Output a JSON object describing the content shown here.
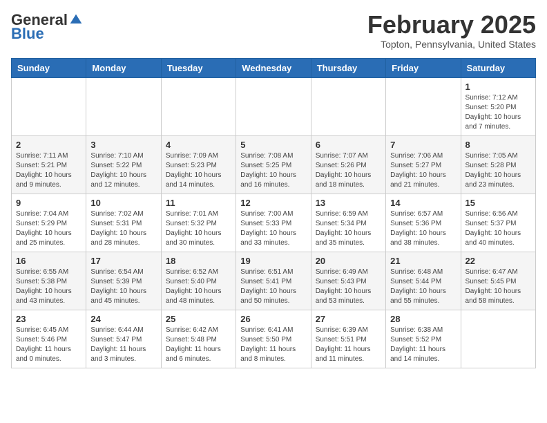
{
  "header": {
    "logo_general": "General",
    "logo_blue": "Blue",
    "month_title": "February 2025",
    "location": "Topton, Pennsylvania, United States"
  },
  "days_of_week": [
    "Sunday",
    "Monday",
    "Tuesday",
    "Wednesday",
    "Thursday",
    "Friday",
    "Saturday"
  ],
  "weeks": [
    [
      {
        "day": "",
        "info": ""
      },
      {
        "day": "",
        "info": ""
      },
      {
        "day": "",
        "info": ""
      },
      {
        "day": "",
        "info": ""
      },
      {
        "day": "",
        "info": ""
      },
      {
        "day": "",
        "info": ""
      },
      {
        "day": "1",
        "info": "Sunrise: 7:12 AM\nSunset: 5:20 PM\nDaylight: 10 hours and 7 minutes."
      }
    ],
    [
      {
        "day": "2",
        "info": "Sunrise: 7:11 AM\nSunset: 5:21 PM\nDaylight: 10 hours and 9 minutes."
      },
      {
        "day": "3",
        "info": "Sunrise: 7:10 AM\nSunset: 5:22 PM\nDaylight: 10 hours and 12 minutes."
      },
      {
        "day": "4",
        "info": "Sunrise: 7:09 AM\nSunset: 5:23 PM\nDaylight: 10 hours and 14 minutes."
      },
      {
        "day": "5",
        "info": "Sunrise: 7:08 AM\nSunset: 5:25 PM\nDaylight: 10 hours and 16 minutes."
      },
      {
        "day": "6",
        "info": "Sunrise: 7:07 AM\nSunset: 5:26 PM\nDaylight: 10 hours and 18 minutes."
      },
      {
        "day": "7",
        "info": "Sunrise: 7:06 AM\nSunset: 5:27 PM\nDaylight: 10 hours and 21 minutes."
      },
      {
        "day": "8",
        "info": "Sunrise: 7:05 AM\nSunset: 5:28 PM\nDaylight: 10 hours and 23 minutes."
      }
    ],
    [
      {
        "day": "9",
        "info": "Sunrise: 7:04 AM\nSunset: 5:29 PM\nDaylight: 10 hours and 25 minutes."
      },
      {
        "day": "10",
        "info": "Sunrise: 7:02 AM\nSunset: 5:31 PM\nDaylight: 10 hours and 28 minutes."
      },
      {
        "day": "11",
        "info": "Sunrise: 7:01 AM\nSunset: 5:32 PM\nDaylight: 10 hours and 30 minutes."
      },
      {
        "day": "12",
        "info": "Sunrise: 7:00 AM\nSunset: 5:33 PM\nDaylight: 10 hours and 33 minutes."
      },
      {
        "day": "13",
        "info": "Sunrise: 6:59 AM\nSunset: 5:34 PM\nDaylight: 10 hours and 35 minutes."
      },
      {
        "day": "14",
        "info": "Sunrise: 6:57 AM\nSunset: 5:36 PM\nDaylight: 10 hours and 38 minutes."
      },
      {
        "day": "15",
        "info": "Sunrise: 6:56 AM\nSunset: 5:37 PM\nDaylight: 10 hours and 40 minutes."
      }
    ],
    [
      {
        "day": "16",
        "info": "Sunrise: 6:55 AM\nSunset: 5:38 PM\nDaylight: 10 hours and 43 minutes."
      },
      {
        "day": "17",
        "info": "Sunrise: 6:54 AM\nSunset: 5:39 PM\nDaylight: 10 hours and 45 minutes."
      },
      {
        "day": "18",
        "info": "Sunrise: 6:52 AM\nSunset: 5:40 PM\nDaylight: 10 hours and 48 minutes."
      },
      {
        "day": "19",
        "info": "Sunrise: 6:51 AM\nSunset: 5:41 PM\nDaylight: 10 hours and 50 minutes."
      },
      {
        "day": "20",
        "info": "Sunrise: 6:49 AM\nSunset: 5:43 PM\nDaylight: 10 hours and 53 minutes."
      },
      {
        "day": "21",
        "info": "Sunrise: 6:48 AM\nSunset: 5:44 PM\nDaylight: 10 hours and 55 minutes."
      },
      {
        "day": "22",
        "info": "Sunrise: 6:47 AM\nSunset: 5:45 PM\nDaylight: 10 hours and 58 minutes."
      }
    ],
    [
      {
        "day": "23",
        "info": "Sunrise: 6:45 AM\nSunset: 5:46 PM\nDaylight: 11 hours and 0 minutes."
      },
      {
        "day": "24",
        "info": "Sunrise: 6:44 AM\nSunset: 5:47 PM\nDaylight: 11 hours and 3 minutes."
      },
      {
        "day": "25",
        "info": "Sunrise: 6:42 AM\nSunset: 5:48 PM\nDaylight: 11 hours and 6 minutes."
      },
      {
        "day": "26",
        "info": "Sunrise: 6:41 AM\nSunset: 5:50 PM\nDaylight: 11 hours and 8 minutes."
      },
      {
        "day": "27",
        "info": "Sunrise: 6:39 AM\nSunset: 5:51 PM\nDaylight: 11 hours and 11 minutes."
      },
      {
        "day": "28",
        "info": "Sunrise: 6:38 AM\nSunset: 5:52 PM\nDaylight: 11 hours and 14 minutes."
      },
      {
        "day": "",
        "info": ""
      }
    ]
  ]
}
